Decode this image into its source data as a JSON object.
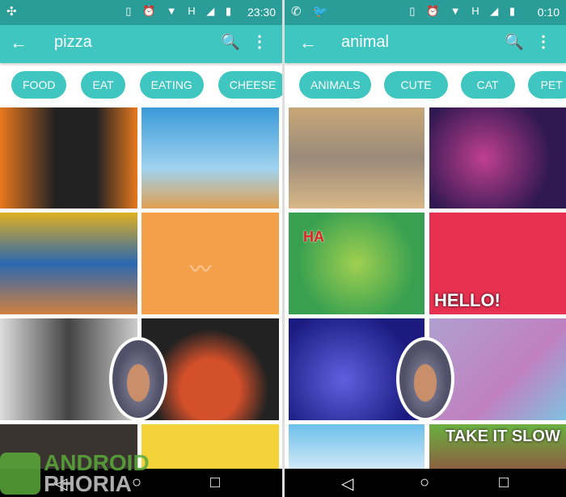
{
  "left": {
    "status": {
      "time": "23:30",
      "icons": "▯ ⏰ ▼ H ◢ ▮",
      "notif": "✣"
    },
    "appbar": {
      "back": "←",
      "title": "pizza",
      "search": "🔍",
      "more": "⋮"
    },
    "chips": [
      "FOOD",
      "EAT",
      "EATING",
      "CHEESE"
    ]
  },
  "right": {
    "status": {
      "time": "0:10",
      "icons": "▯ ⏰ ▼ H ◢ ▮",
      "notif": "✆ 🐦"
    },
    "appbar": {
      "back": "←",
      "title": "animal",
      "search": "🔍",
      "more": "⋮"
    },
    "chips": [
      "ANIMALS",
      "CUTE",
      "CAT",
      "PET"
    ],
    "tile_texts": {
      "ha": "HA",
      "hello": "HELLO!",
      "take": "TAKE IT SLOW"
    }
  },
  "nav": {
    "back": "◁",
    "home": "○",
    "recents": "□"
  },
  "watermark": {
    "line1": "ANDROID",
    "line2": "PHORIA"
  },
  "colors": {
    "accent": "#3fc6c1",
    "status": "#2a9d98"
  }
}
